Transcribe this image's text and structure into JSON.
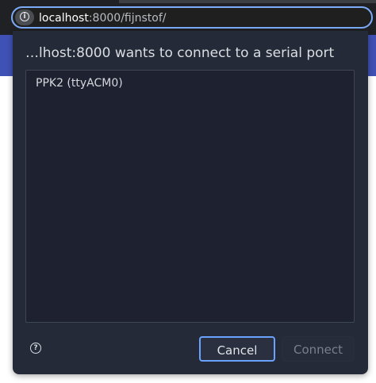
{
  "address_bar": {
    "info_icon": "info-icon",
    "host": "localhost",
    "rest": ":8000/fijnstof/"
  },
  "dialog": {
    "title": "…lhost:8000 wants to connect to a serial port",
    "devices": [
      {
        "label": "PPK2 (ttyACM0)"
      }
    ],
    "help_icon": "help-circle-icon",
    "help_glyph": "?",
    "info_glyph": "i",
    "cancel_label": "Cancel",
    "connect_label": "Connect",
    "connect_enabled": false
  },
  "colors": {
    "accent": "#6aa2ff",
    "dialog_bg": "#242a37",
    "page_header": "#3f51b5",
    "browser_chrome": "#202124"
  }
}
